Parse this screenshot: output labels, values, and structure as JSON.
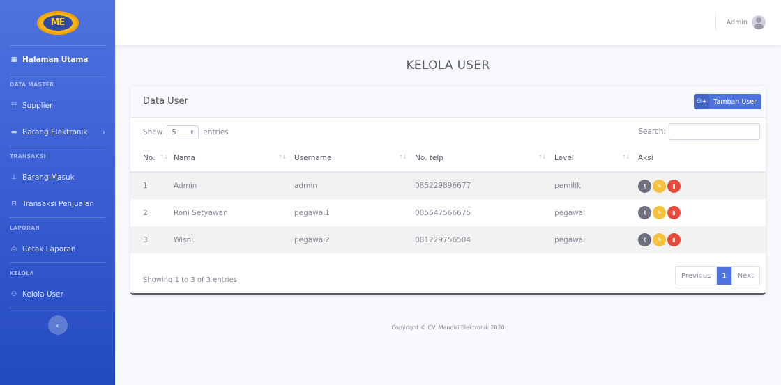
{
  "sidebar": {
    "logo_text": "ME",
    "dashboard": "Halaman Utama",
    "sections": [
      {
        "heading": "DATA MASTER",
        "items": [
          "Supplier",
          "Barang Elektronik"
        ]
      },
      {
        "heading": "TRANSAKSI",
        "items": [
          "Barang Masuk",
          "Transaksi Penjualan"
        ]
      },
      {
        "heading": "LAPORAN",
        "items": [
          "Cetak Laporan"
        ]
      },
      {
        "heading": "KELOLA",
        "items": [
          "Kelola User"
        ]
      }
    ],
    "toggle": "‹"
  },
  "topbar": {
    "user_name": "Admin"
  },
  "page_title": "KELOLA USER",
  "card": {
    "title": "Data User",
    "add_button": "Tambah User",
    "show_label": "Show",
    "entries_label": "entries",
    "page_length": "5",
    "search_label": "Search:",
    "search_value": "",
    "columns": [
      "No.",
      "Nama",
      "Username",
      "No. telp",
      "Level",
      "Aksi"
    ],
    "rows": [
      {
        "no": "1",
        "nama": "Admin",
        "username": "admin",
        "telp": "085229896677",
        "level": "pemilik"
      },
      {
        "no": "2",
        "nama": "Roni Setyawan",
        "username": "pegawai1",
        "telp": "085647566675",
        "level": "pegawai"
      },
      {
        "no": "3",
        "nama": "Wisnu",
        "username": "pegawai2",
        "telp": "081229756504",
        "level": "pegawai"
      }
    ],
    "info": "Showing 1 to 3 of 3 entries",
    "pagination": {
      "previous": "Previous",
      "current": "1",
      "next": "Next"
    }
  },
  "footer": {
    "copyright": "Copyright © CV. Mandiri Elektronik 2020"
  },
  "colors": {
    "primary": "#4e73df",
    "warning": "#f6c23e",
    "danger": "#e74a3b",
    "secondary": "#6e707e"
  }
}
